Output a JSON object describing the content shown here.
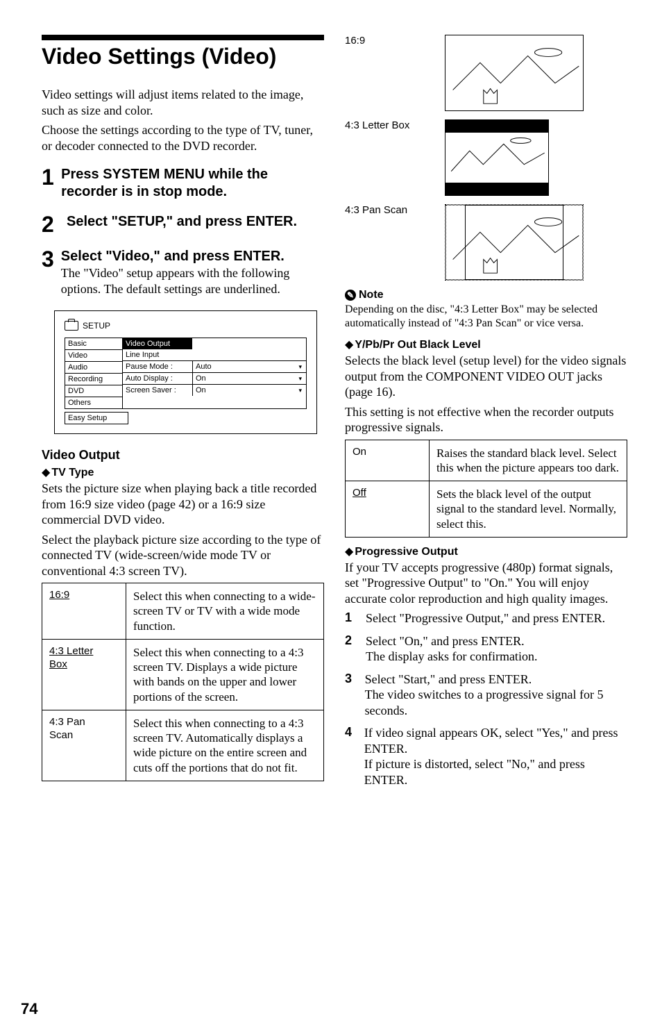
{
  "page_number": "74",
  "left": {
    "title": "Video Settings (Video)",
    "intro1": "Video settings will adjust items related to the image, such as size and color.",
    "intro2": "Choose the settings according to the type of TV, tuner, or decoder connected to the DVD recorder.",
    "steps": [
      {
        "head": "Press SYSTEM MENU while the recorder is in stop mode.",
        "body": ""
      },
      {
        "head": "Select \"SETUP,\" and press ENTER.",
        "body": ""
      },
      {
        "head": "Select \"Video,\" and press ENTER.",
        "body": "The \"Video\" setup appears with the following options. The default settings are underlined."
      }
    ],
    "setup": {
      "label": "SETUP",
      "left_items": [
        "Basic",
        "Video",
        "Audio",
        "Recording",
        "DVD",
        "Others"
      ],
      "tab": "Video Output",
      "row2": "Line Input",
      "rows": [
        {
          "k": "Pause Mode :",
          "v": "Auto"
        },
        {
          "k": "Auto Display :",
          "v": "On"
        },
        {
          "k": "Screen Saver :",
          "v": "On"
        }
      ],
      "easy": "Easy Setup"
    },
    "video_output_head": "Video Output",
    "tv_type_head": "TV Type",
    "tv_type_body1": "Sets the picture size when playing back a title recorded from 16:9 size video (page 42) or a 16:9 size commercial DVD video.",
    "tv_type_body2": "Select the playback picture size according to the type of connected TV (wide-screen/wide mode TV or conventional 4:3 screen TV).",
    "tv_type_table": [
      {
        "k": "16:9",
        "v": "Select this when connecting to a wide-screen TV or TV with a wide mode function.",
        "u": true
      },
      {
        "k": "4:3 Letter Box",
        "v": "Select this when connecting to a 4:3 screen TV. Displays a wide picture with bands on the upper and lower portions of the screen.",
        "u": true
      },
      {
        "k": "4:3 Pan Scan",
        "v": "Select this when connecting to a 4:3 screen TV. Automatically displays a wide picture on the entire screen and cuts off the portions that do not fit.",
        "u": false
      }
    ]
  },
  "right": {
    "thumbs": [
      {
        "label": "16:9"
      },
      {
        "label": "4:3 Letter Box"
      },
      {
        "label": "4:3 Pan Scan"
      }
    ],
    "note_head": "Note",
    "note_body": "Depending on the disc, \"4:3 Letter Box\" may be selected automatically instead of \"4:3 Pan Scan\" or vice versa.",
    "ypbpr_head": "Y/Pb/Pr Out Black Level",
    "ypbpr_body1": "Selects the black level (setup level) for the video signals output from the COMPONENT VIDEO OUT jacks (page 16).",
    "ypbpr_body2": "This setting is not effective when the recorder outputs progressive signals.",
    "ypbpr_table": [
      {
        "k": "On",
        "v": "Raises the standard black level. Select this when the picture appears too dark.",
        "u": false
      },
      {
        "k": "Off",
        "v": "Sets the black level of the output signal to the standard level. Normally, select this.",
        "u": true
      }
    ],
    "prog_head": "Progressive Output",
    "prog_body": "If your TV accepts progressive (480p) format signals, set \"Progressive Output\" to \"On.\" You will enjoy accurate color reproduction and high quality images.",
    "prog_steps": [
      "Select \"Progressive Output,\" and press ENTER.",
      "Select \"On,\" and press ENTER.\nThe display asks for confirmation.",
      "Select \"Start,\" and press ENTER.\nThe video switches to a progressive signal for 5 seconds.",
      "If video signal appears OK, select \"Yes,\" and press ENTER.\nIf picture is distorted, select \"No,\" and press ENTER."
    ]
  }
}
